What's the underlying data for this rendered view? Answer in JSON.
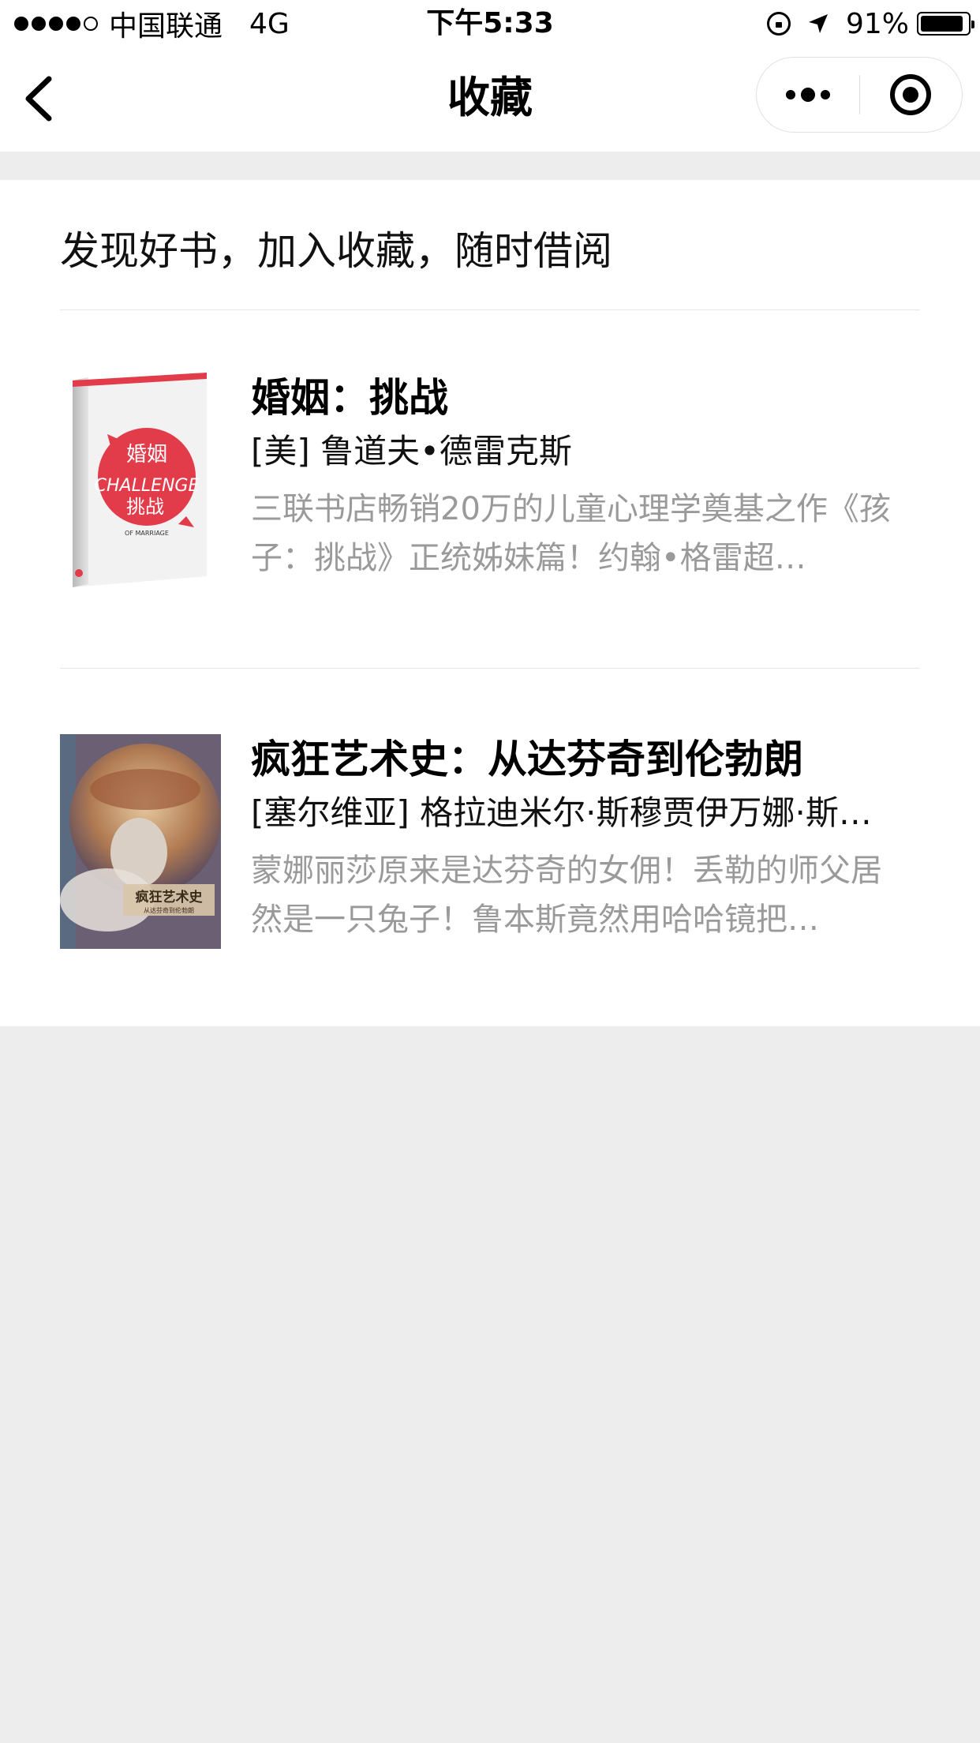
{
  "status_bar": {
    "carrier": "中国联通",
    "network": "4G",
    "time": "下午5:33",
    "battery_percent_text": "91%",
    "battery_level": 0.91,
    "icons": [
      "signal-dots",
      "orientation-lock-icon",
      "location-arrow-icon",
      "battery-icon"
    ]
  },
  "nav": {
    "title": "收藏",
    "back_icon": "chevron-left-icon",
    "more_icon": "more-dots-icon",
    "close_icon": "target-circle-icon"
  },
  "intro": "发现好书，加入收藏，随时借阅",
  "books": [
    {
      "title": "婚姻：挑战",
      "author": "[美] 鲁道夫•德雷克斯",
      "description": "三联书店畅销20万的儿童心理学奠基之作《孩子：挑战》正统姊妹篇！约翰•格雷超…",
      "cover_accent": "#e23b4a"
    },
    {
      "title": "疯狂艺术史：从达芬奇到伦勃朗",
      "author": "[塞尔维亚] 格拉迪米尔·斯穆贾伊万娜·斯…",
      "description": "蒙娜丽莎原来是达芬奇的女佣！丢勒的师父居然是一只兔子！鲁本斯竟然用哈哈镜把…",
      "cover_accent": "#8a6a52"
    }
  ],
  "colors": {
    "background": "#ededed",
    "card": "#ffffff",
    "muted_text": "#9a9a9a"
  }
}
